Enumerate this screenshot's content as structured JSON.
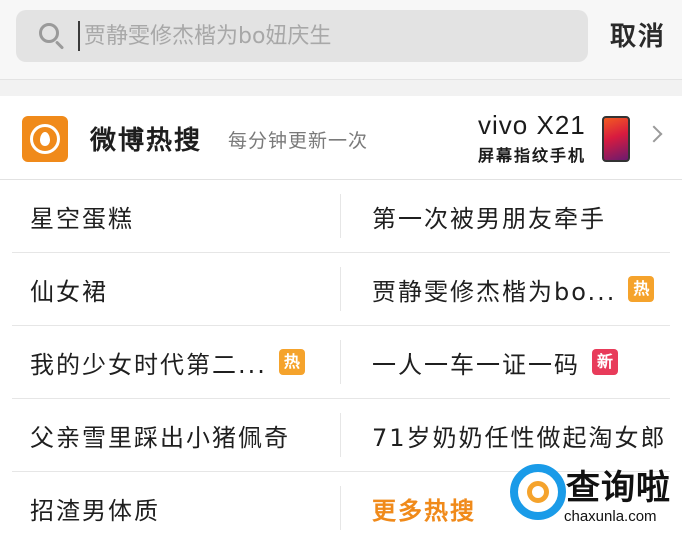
{
  "search": {
    "placeholder": "贾静雯修杰楷为bo妞庆生",
    "cancel_label": "取消"
  },
  "banner": {
    "title": "微博热搜",
    "subtitle": "每分钟更新一次",
    "ad_brand": "vivo",
    "ad_model": "X21",
    "ad_slogan": "屏幕指纹手机"
  },
  "hot_list": [
    {
      "left": {
        "text": "星空蛋糕",
        "badge": ""
      },
      "right": {
        "text": "第一次被男朋友牵手",
        "badge": ""
      }
    },
    {
      "left": {
        "text": "仙女裙",
        "badge": ""
      },
      "right": {
        "text": "贾静雯修杰楷为bo...",
        "badge": "热"
      }
    },
    {
      "left": {
        "text": "我的少女时代第二...",
        "badge": "热"
      },
      "right": {
        "text": "一人一车一证一码",
        "badge": "新"
      }
    },
    {
      "left": {
        "text": "父亲雪里踩出小猪佩奇",
        "badge": ""
      },
      "right": {
        "text": "71岁奶奶任性做起淘女郎",
        "badge": ""
      }
    },
    {
      "left": {
        "text": "招渣男体质",
        "badge": ""
      },
      "right": {
        "text": "更多热搜",
        "badge": ""
      }
    }
  ],
  "watermark": {
    "name": "查询啦",
    "url": "chaxunla.com"
  },
  "colors": {
    "accent": "#f08a1a",
    "hot_badge": "#f5a32c",
    "new_badge": "#e83b5a"
  }
}
